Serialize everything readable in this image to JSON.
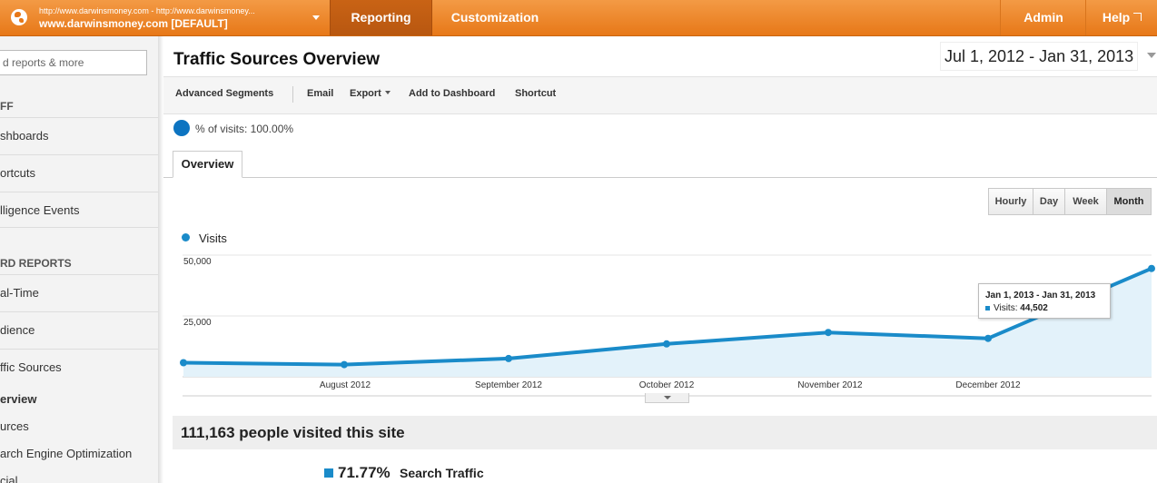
{
  "topbar": {
    "account_urls": "http://www.darwinsmoney.com - http://www.darwinsmoney...",
    "account_name": "www.darwinsmoney.com [DEFAULT]",
    "tabs": {
      "reporting": "Reporting",
      "customization": "Customization",
      "admin": "Admin",
      "help": "Help"
    }
  },
  "sidebar": {
    "search_placeholder": "d reports & more",
    "section1": "FF",
    "items": [
      "shboards",
      "ortcuts",
      "lligence Events"
    ],
    "section2": "RD REPORTS",
    "report_items": [
      "al-Time",
      "dience",
      "ffic Sources"
    ],
    "sub_items": {
      "overview": "erview",
      "sources": "urces",
      "seo": "arch Engine Optimization",
      "social": "cial"
    }
  },
  "main": {
    "title": "Traffic Sources Overview",
    "date_range": "Jul 1, 2012 - Jan 31, 2013",
    "toolbar": {
      "advanced_segments": "Advanced Segments",
      "email": "Email",
      "export": "Export",
      "add_to_dashboard": "Add to Dashboard",
      "shortcut": "Shortcut"
    },
    "segment_label": "% of visits: 100.00%",
    "tab_overview": "Overview",
    "granularity": {
      "hourly": "Hourly",
      "day": "Day",
      "week": "Week",
      "month": "Month",
      "active": "Month"
    },
    "tooltip": {
      "date": "Jan 1, 2013 - Jan 31, 2013",
      "label": "Visits:",
      "value": "44,502"
    },
    "summary": "111,163 people visited this site",
    "search_traffic": {
      "pct": "71.77%",
      "label": "Search Traffic"
    }
  },
  "colors": {
    "accent": "#e77818",
    "series": "#1a8bc9"
  },
  "chart_data": {
    "type": "area",
    "series": [
      {
        "name": "Visits",
        "values": [
          5800,
          5000,
          7500,
          13500,
          18200,
          15800,
          44502
        ]
      }
    ],
    "x": [
      "Jul 2012",
      "Aug 2012",
      "Sep 2012",
      "Oct 2012",
      "Nov 2012",
      "Dec 2012",
      "Jan 2013"
    ],
    "x_tick_labels": [
      "August 2012",
      "September 2012",
      "October 2012",
      "November 2012",
      "December 2012"
    ],
    "y_ticks": [
      "50,000",
      "25,000"
    ],
    "ylim": [
      0,
      50000
    ],
    "grid": true,
    "legend": "top-left"
  }
}
